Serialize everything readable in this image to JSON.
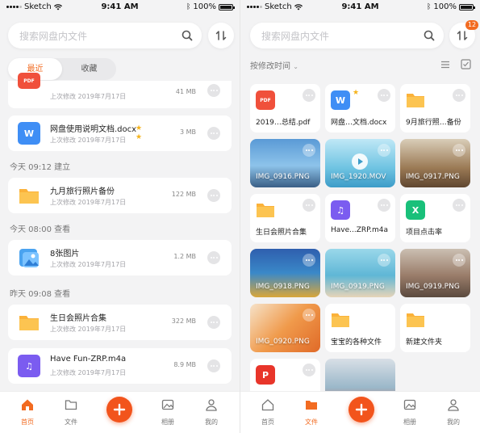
{
  "status": {
    "carrier": "Sketch",
    "time": "9:41 AM",
    "battery": "100%"
  },
  "left": {
    "search_placeholder": "搜索网盘内文件",
    "segments": [
      "最近",
      "收藏"
    ],
    "top_partial": {
      "sub": "上次修改 2019年7月17日",
      "size": "41 MB",
      "icon": "pdf-icon"
    },
    "items": [
      {
        "name": "网盘使用说明文档.docx",
        "sub": "上次修改 2019年7月17日",
        "size": "3 MB",
        "icon": "word-icon",
        "starred": true
      }
    ],
    "sections": [
      {
        "heading": "今天 09:12 建立",
        "item": {
          "name": "九月旅行照片备份",
          "sub": "上次修改 2019年7月17日",
          "size": "122 MB",
          "icon": "folder-icon"
        }
      },
      {
        "heading": "今天 08:00 查看",
        "item": {
          "name": "8张图片",
          "sub": "上次修改 2019年7月17日",
          "size": "1.2 MB",
          "icon": "image-icon"
        }
      },
      {
        "heading": "昨天 09:08 查看",
        "item": {
          "name": "生日会照片合集",
          "sub": "上次修改 2019年7月17日",
          "size": "322 MB",
          "icon": "folder-icon"
        }
      }
    ],
    "last_item": {
      "name": "Have Fun-ZRP.m4a",
      "sub": "上次修改 2019年7月17日",
      "size": "8.9 MB",
      "icon": "music-icon"
    },
    "tabs": [
      {
        "label": "首页",
        "icon": "home-icon",
        "active": true
      },
      {
        "label": "文件",
        "icon": "folder-tab-icon",
        "active": false
      },
      {
        "label": "相册",
        "icon": "album-icon",
        "active": false
      },
      {
        "label": "我的",
        "icon": "profile-icon",
        "active": false
      }
    ]
  },
  "right": {
    "search_placeholder": "搜索网盘内文件",
    "sort_badge": "12",
    "sort_label": "按修改时间",
    "tiles": [
      {
        "name": "2019…总结.pdf",
        "type": "pdf"
      },
      {
        "name": "网盘…文档.docx",
        "type": "word",
        "starred": true
      },
      {
        "name": "9月旅行照…备份",
        "type": "folder"
      },
      {
        "name": "IMG_0916.PNG",
        "type": "photo",
        "color": "#6aa7d8"
      },
      {
        "name": "IMG_1920.MOV",
        "type": "video",
        "color": "#7cc8e6"
      },
      {
        "name": "IMG_0917.PNG",
        "type": "photo",
        "color": "#b79a6e"
      },
      {
        "name": "生日会照片合集",
        "type": "folder"
      },
      {
        "name": "Have...ZRP.m4a",
        "type": "music"
      },
      {
        "name": "项目点击率",
        "type": "excel"
      },
      {
        "name": "IMG_0918.PNG",
        "type": "photo",
        "color": "#3f6fb0"
      },
      {
        "name": "IMG_0919.PNG",
        "type": "photo",
        "color": "#8fd0e0"
      },
      {
        "name": "IMG_0919.PNG",
        "type": "photo",
        "color": "#a58a78"
      },
      {
        "name": "IMG_0920.PNG",
        "type": "photo",
        "color": "#e7833a"
      },
      {
        "name": "宝宝的各种文件",
        "type": "folder"
      },
      {
        "name": "新建文件夹",
        "type": "folder"
      },
      {
        "name": "",
        "type": "ppt"
      },
      {
        "name": "",
        "type": "photo",
        "color": "#9ab7c9"
      }
    ],
    "tabs": [
      {
        "label": "首页",
        "icon": "home-icon",
        "active": false
      },
      {
        "label": "文件",
        "icon": "folder-tab-icon",
        "active": true
      },
      {
        "label": "相册",
        "icon": "album-icon",
        "active": false
      },
      {
        "label": "我的",
        "icon": "profile-icon",
        "active": false
      }
    ]
  },
  "colors": {
    "accent": "#f26b21",
    "fab": "#f2541c",
    "folder": "#fbb23a",
    "word": "#3f8ef5",
    "pdf": "#f0503b",
    "music": "#7b5cf0",
    "excel": "#19c07a"
  }
}
